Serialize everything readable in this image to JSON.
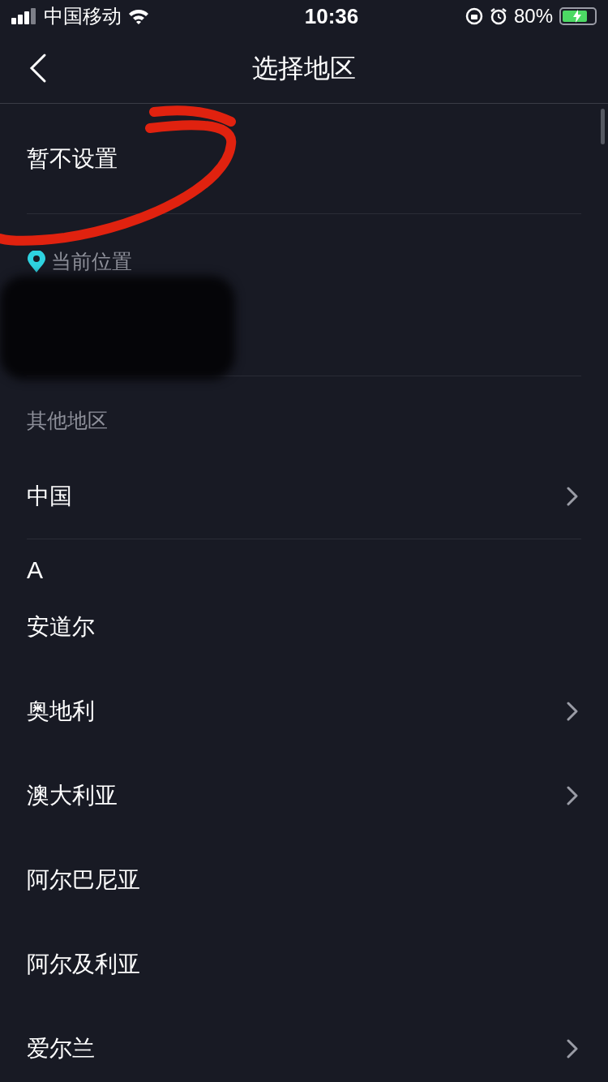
{
  "status_bar": {
    "carrier": "中国移动",
    "time": "10:36",
    "battery": "80%",
    "charging": true
  },
  "nav": {
    "title": "选择地区"
  },
  "not_set": {
    "label": "暂不设置",
    "annotated": true
  },
  "current": {
    "label": "当前位置",
    "redacted": true
  },
  "other": {
    "label": "其他地区"
  },
  "groups": [
    {
      "items": [
        {
          "name": "中国",
          "has_children": true
        }
      ]
    },
    {
      "header": "A",
      "items": [
        {
          "name": "安道尔",
          "has_children": false
        },
        {
          "name": "奥地利",
          "has_children": true
        },
        {
          "name": "澳大利亚",
          "has_children": true
        },
        {
          "name": "阿尔巴尼亚",
          "has_children": false
        },
        {
          "name": "阿尔及利亚",
          "has_children": false
        },
        {
          "name": "爱尔兰",
          "has_children": true
        }
      ]
    }
  ]
}
